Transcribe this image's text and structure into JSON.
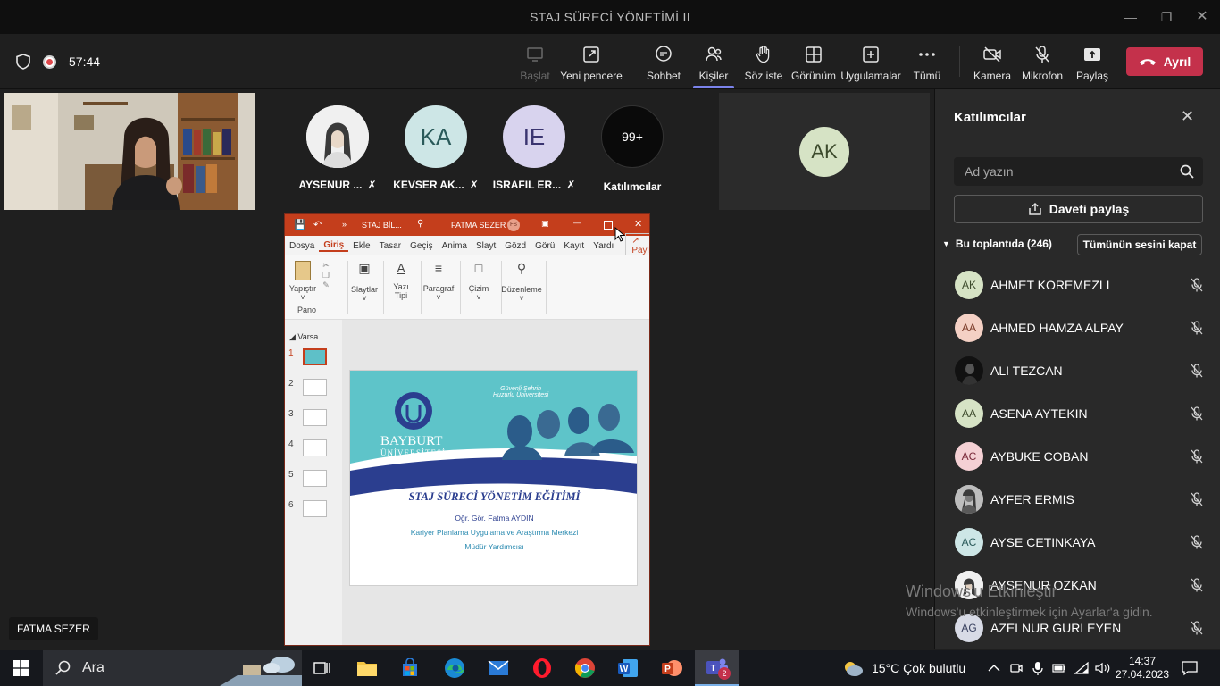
{
  "window": {
    "title": "STAJ SÜRECİ YÖNETİMİ II"
  },
  "toolbar": {
    "timer": "57:44",
    "buttons": {
      "start": "Başlat",
      "new_window": "Yeni pencere",
      "chat": "Sohbet",
      "people": "Kişiler",
      "raise_hand": "Söz iste",
      "view": "Görünüm",
      "apps": "Uygulamalar",
      "more": "Tümü",
      "camera": "Kamera",
      "mic": "Mikrofon",
      "share": "Paylaş",
      "leave": "Ayrıl"
    }
  },
  "gallery": [
    {
      "initials": "",
      "name": "AYSENUR ...",
      "color": "#e8e8e8"
    },
    {
      "initials": "KA",
      "name": "KEVSER AK...",
      "color": "#cde6e6"
    },
    {
      "initials": "IE",
      "name": "ISRAFIL ER...",
      "color": "#d8d3ee"
    },
    {
      "initials": "99+",
      "name": "Katılımcılar",
      "color": "#0a0a0a"
    }
  ],
  "stage_tile": {
    "initials": "AK"
  },
  "presenter": {
    "name": "FATMA SEZER"
  },
  "ppt": {
    "file": "STAJ BİL...",
    "user": "FATMA SEZER",
    "user_initials": "FS",
    "tabs": [
      "Dosya",
      "Giriş",
      "Ekle",
      "Tasar",
      "Geçiş",
      "Anima",
      "Slayt",
      "Gözd",
      "Görü",
      "Kayıt",
      "Yardı"
    ],
    "share": "Paylaş",
    "ribbon": {
      "paste": "Yapıştır",
      "clipboard": "Pano",
      "slides": "Slaytlar",
      "font": "Yazı Tipi",
      "paragraph": "Paragraf",
      "drawing": "Çizim",
      "editing": "Düzenleme"
    },
    "section": "Varsa...",
    "slide_numbers": [
      "1",
      "2",
      "3",
      "4",
      "5",
      "6"
    ],
    "slide": {
      "tagline1": "Güvenli Şehrin",
      "tagline2": "Huzurlu Üniversitesi",
      "logo1": "BAYBURT",
      "logo2": "ÜNİVERSİTESİ",
      "title": "STAJ SÜRECİ YÖNETİM EĞİTİMİ",
      "line1": "Öğr. Gör. Fatma AYDIN",
      "line2": "Kariyer Planlama Uygulama ve Araştırma Merkezi",
      "line3": "Müdür Yardımcısı"
    }
  },
  "panel": {
    "title": "Katılımcılar",
    "search_placeholder": "Ad yazın",
    "invite": "Daveti paylaş",
    "in_meeting": "Bu toplantıda (246)",
    "mute_all": "Tümünün sesini kapat",
    "participants": [
      {
        "initials": "AK",
        "name": "AHMET KOREMEZLI",
        "bg": "#d6e3c5",
        "fg": "#3c4a2c"
      },
      {
        "initials": "AA",
        "name": "AHMED HAMZA ALPAY",
        "bg": "#f4d0c4",
        "fg": "#7a3a28"
      },
      {
        "initials": "",
        "name": "ALI TEZCAN",
        "bg": "#111111",
        "fg": "#fff"
      },
      {
        "initials": "AA",
        "name": "ASENA AYTEKIN",
        "bg": "#d6e3c5",
        "fg": "#3c4a2c"
      },
      {
        "initials": "AC",
        "name": "AYBUKE COBAN",
        "bg": "#f4d0d4",
        "fg": "#7a2a3a"
      },
      {
        "initials": "",
        "name": "AYFER ERMIS",
        "bg": "#9a9a9a",
        "fg": "#fff"
      },
      {
        "initials": "AC",
        "name": "AYSE CETINKAYA",
        "bg": "#cde6e6",
        "fg": "#2a5a5a"
      },
      {
        "initials": "",
        "name": "AYSENUR OZKAN",
        "bg": "#e8e8e8",
        "fg": "#333"
      },
      {
        "initials": "AG",
        "name": "AZELNUR GURLEYEN",
        "bg": "#d8dbe6",
        "fg": "#3a4260"
      }
    ]
  },
  "watermark": {
    "line1": "Windows'u Etkinleştir",
    "line2": "Windows'u etkinleştirmek için Ayarlar'a gidin."
  },
  "taskbar": {
    "search": "Ara",
    "weather": "15°C  Çok bulutlu",
    "time": "14:37",
    "date": "27.04.2023",
    "teams_badge": "2"
  }
}
